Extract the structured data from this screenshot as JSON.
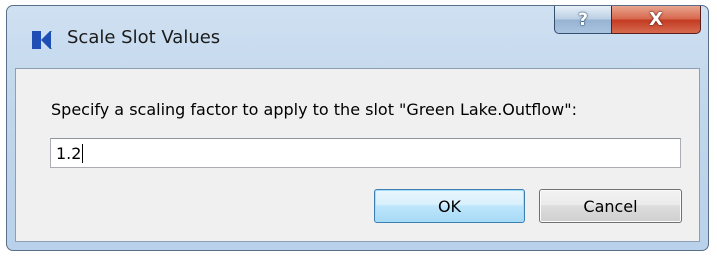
{
  "window": {
    "title": "Scale Slot Values",
    "app_icon": "riverware-logo-icon",
    "help_button": {
      "label": "?",
      "icon": "help-icon"
    },
    "close_button": {
      "label": "X",
      "icon": "close-icon"
    }
  },
  "form": {
    "prompt": "Specify a scaling factor to apply to the slot \"Green Lake.Outflow\":",
    "scale_value": "1.2"
  },
  "buttons": {
    "ok_label": "OK",
    "cancel_label": "Cancel"
  },
  "colors": {
    "title_bar": "#c0d6ec",
    "close_button": "#c33a22",
    "default_button_border": "#3c7fb1",
    "app_icon_blue": "#1f4fb4"
  }
}
